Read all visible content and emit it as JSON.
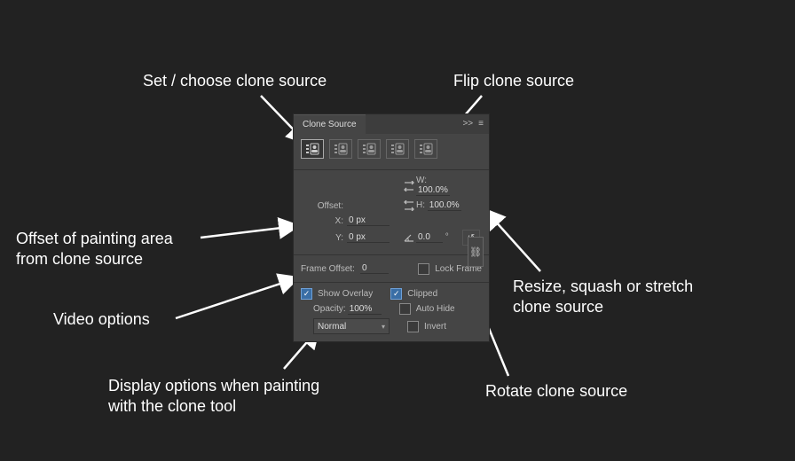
{
  "annotations": {
    "source": "Set / choose clone source",
    "flip": "Flip clone source",
    "offset1": "Offset of painting area",
    "offset2": "from clone source",
    "video": "Video options",
    "display1": "Display options when painting",
    "display2": "with the clone tool",
    "resize1": "Resize, squash or stretch",
    "resize2": "clone source",
    "rotate": "Rotate clone source"
  },
  "panel": {
    "title": "Clone Source",
    "collapse": ">>",
    "menu": "≡",
    "offset_label": "Offset:",
    "x_label": "X:",
    "x_value": "0 px",
    "y_label": "Y:",
    "y_value": "0 px",
    "w_label": "W:",
    "w_value": "100.0%",
    "h_label": "H:",
    "h_value": "100.0%",
    "angle_value": "0.0",
    "degree": "°",
    "reset": "↺",
    "link": "⛓",
    "frame_offset_label": "Frame Offset:",
    "frame_offset_value": "0",
    "lock_frame": "Lock Frame",
    "show_overlay": "Show Overlay",
    "clipped": "Clipped",
    "opacity_label": "Opacity:",
    "opacity_value": "100%",
    "auto_hide": "Auto Hide",
    "blend_mode": "Normal",
    "invert": "Invert"
  }
}
